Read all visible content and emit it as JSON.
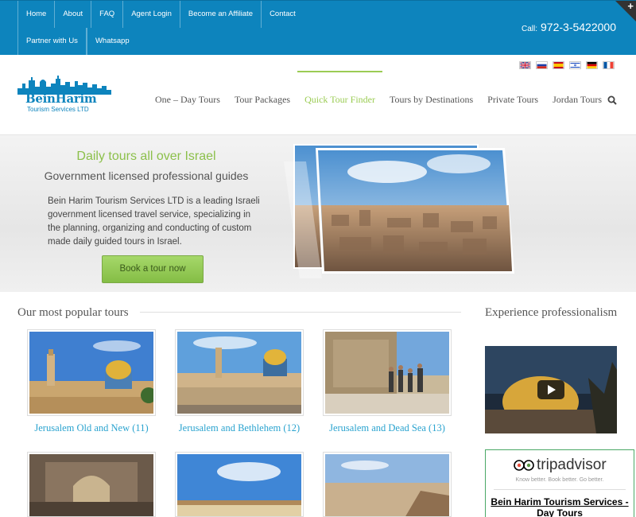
{
  "topbar": {
    "nav": [
      "Home",
      "About",
      "FAQ",
      "Agent Login",
      "Become an Affiliate",
      "Contact",
      "Partner with Us",
      "Whatsapp"
    ],
    "call_label": "Call:",
    "phone": "972-3-5422000"
  },
  "header": {
    "logo_text": "BeinHarim",
    "logo_sub": "Tourism Services LTD",
    "flags": [
      "uk-flag",
      "russia-flag",
      "spain-flag",
      "israel-flag",
      "germany-flag",
      "france-flag"
    ],
    "nav": [
      "One – Day Tours",
      "Tour Packages",
      "Quick Tour Finder",
      "Tours by Destinations",
      "Private Tours",
      "Jordan Tours"
    ],
    "active_nav": "Quick Tour Finder"
  },
  "hero": {
    "title": "Daily tours all over Israel",
    "subtitle": "Government licensed professional guides",
    "body": "Bein Harim Tourism Services LTD is a leading Israeli government licensed travel service, specializing in the planning, organizing and conducting of custom made daily guided tours in Israel.",
    "button": "Book a tour now"
  },
  "popular": {
    "title": "Our most popular tours",
    "tours": [
      {
        "caption": "Jerusalem Old and New (11)"
      },
      {
        "caption": "Jerusalem and Bethlehem (12)"
      },
      {
        "caption": "Jerusalem and Dead Sea (13)"
      }
    ]
  },
  "sidebar": {
    "title": "Experience professionalism",
    "tripadvisor": {
      "logo": "tripadvisor",
      "tagline": "Know better. Book better. Go better.",
      "name": "Bein Harim Tourism Services - Day Tours"
    }
  },
  "colors": {
    "topbar": "#0d84bd",
    "accent_green": "#8cc04b",
    "link_blue": "#2aa3cf"
  }
}
